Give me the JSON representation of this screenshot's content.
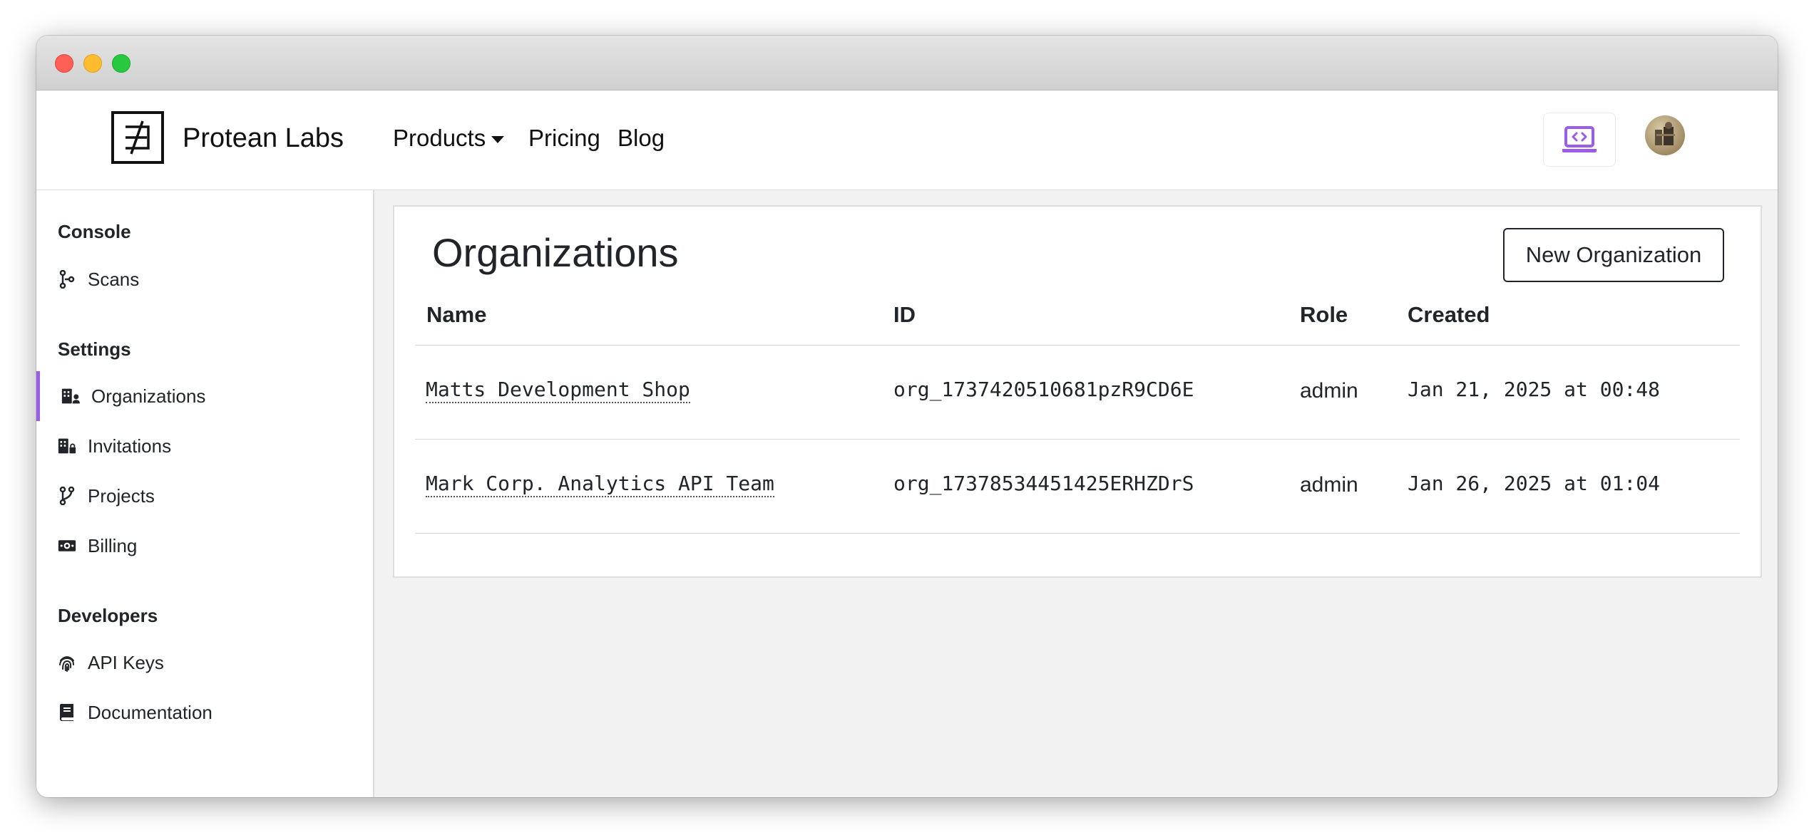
{
  "brand": {
    "name": "Protean Labs"
  },
  "nav": {
    "products": "Products",
    "pricing": "Pricing",
    "blog": "Blog"
  },
  "sidebar": {
    "sections": [
      {
        "title": "Console",
        "items": [
          {
            "label": "Scans",
            "icon": "git-commit-icon"
          }
        ]
      },
      {
        "title": "Settings",
        "items": [
          {
            "label": "Organizations",
            "icon": "building-user-icon",
            "active": true
          },
          {
            "label": "Invitations",
            "icon": "building-lock-icon"
          },
          {
            "label": "Projects",
            "icon": "git-branch-icon"
          },
          {
            "label": "Billing",
            "icon": "money-bill-icon"
          }
        ]
      },
      {
        "title": "Developers",
        "items": [
          {
            "label": "API Keys",
            "icon": "fingerprint-icon"
          },
          {
            "label": "Documentation",
            "icon": "book-icon"
          }
        ]
      }
    ]
  },
  "main": {
    "title": "Organizations",
    "new_button": "New Organization",
    "columns": [
      "Name",
      "ID",
      "Role",
      "Created"
    ],
    "rows": [
      {
        "name": "Matts Development Shop",
        "id": "org_1737420510681pzR9CD6E",
        "role": "admin",
        "created": "Jan 21, 2025 at 00:48"
      },
      {
        "name": "Mark Corp. Analytics API Team",
        "id": "org_17378534451425ERHZDrS",
        "role": "admin",
        "created": "Jan 26, 2025 at 01:04"
      }
    ]
  },
  "colors": {
    "accent": "#9b5de5"
  }
}
